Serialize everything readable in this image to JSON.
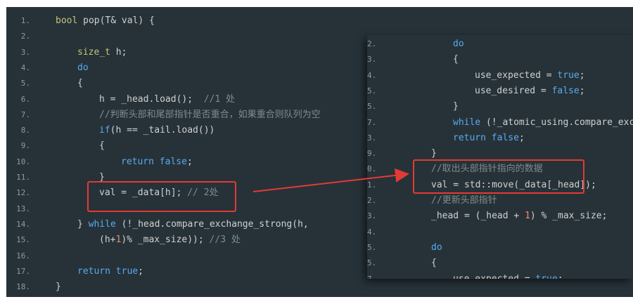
{
  "left_panel": {
    "lines": [
      {
        "n": "1.",
        "indent": 0,
        "tokens": [
          {
            "t": "bool",
            "c": "ty"
          },
          {
            "t": " pop(T& val) {",
            "c": "pl"
          }
        ]
      },
      {
        "n": "2.",
        "indent": 0,
        "tokens": []
      },
      {
        "n": "3.",
        "indent": 1,
        "tokens": [
          {
            "t": "size_t",
            "c": "ty"
          },
          {
            "t": " h;",
            "c": "pl"
          }
        ]
      },
      {
        "n": "4.",
        "indent": 1,
        "tokens": [
          {
            "t": "do",
            "c": "kw"
          }
        ]
      },
      {
        "n": "5.",
        "indent": 1,
        "tokens": [
          {
            "t": "{",
            "c": "pl"
          }
        ]
      },
      {
        "n": "6.",
        "indent": 2,
        "tokens": [
          {
            "t": "h = _head.load();  ",
            "c": "pl"
          },
          {
            "t": "//1 处",
            "c": "cm"
          }
        ]
      },
      {
        "n": "7.",
        "indent": 2,
        "tokens": [
          {
            "t": "//判断头部和尾部指针是否重合，如果重合则队列为空",
            "c": "cm"
          }
        ]
      },
      {
        "n": "8.",
        "indent": 2,
        "tokens": [
          {
            "t": "if",
            "c": "kw"
          },
          {
            "t": "(h == _tail.load())",
            "c": "pl"
          }
        ]
      },
      {
        "n": "9.",
        "indent": 2,
        "tokens": [
          {
            "t": "{",
            "c": "pl"
          }
        ]
      },
      {
        "n": "10.",
        "indent": 3,
        "tokens": [
          {
            "t": "return",
            "c": "kw"
          },
          {
            "t": " ",
            "c": "pl"
          },
          {
            "t": "false",
            "c": "kw"
          },
          {
            "t": ";",
            "c": "pl"
          }
        ]
      },
      {
        "n": "11.",
        "indent": 2,
        "tokens": [
          {
            "t": "}",
            "c": "pl"
          }
        ]
      },
      {
        "n": "12.",
        "indent": 2,
        "tokens": [
          {
            "t": "val = _data[h]; ",
            "c": "pl"
          },
          {
            "t": "// 2处",
            "c": "cm"
          }
        ]
      },
      {
        "n": "13.",
        "indent": 0,
        "tokens": []
      },
      {
        "n": "14.",
        "indent": 1,
        "tokens": [
          {
            "t": "} ",
            "c": "pl"
          },
          {
            "t": "while",
            "c": "kw"
          },
          {
            "t": " (!_head.compare_exchange_strong(h,",
            "c": "pl"
          }
        ]
      },
      {
        "n": "15.",
        "indent": 2,
        "tokens": [
          {
            "t": "(h+",
            "c": "pl"
          },
          {
            "t": "1",
            "c": "nm"
          },
          {
            "t": ")% _max_size)); ",
            "c": "pl"
          },
          {
            "t": "//3 处",
            "c": "cm"
          }
        ]
      },
      {
        "n": "16.",
        "indent": 0,
        "tokens": []
      },
      {
        "n": "17.",
        "indent": 1,
        "tokens": [
          {
            "t": "return",
            "c": "kw"
          },
          {
            "t": " ",
            "c": "pl"
          },
          {
            "t": "true",
            "c": "kw"
          },
          {
            "t": ";",
            "c": "pl"
          }
        ]
      },
      {
        "n": "18.",
        "indent": 0,
        "tokens": [
          {
            "t": "}",
            "c": "pl"
          }
        ]
      }
    ]
  },
  "popup_panel": {
    "lines": [
      {
        "n": "2.",
        "indent": 3,
        "tokens": [
          {
            "t": "do",
            "c": "kw"
          }
        ]
      },
      {
        "n": "3.",
        "indent": 3,
        "tokens": [
          {
            "t": "{",
            "c": "pl"
          }
        ]
      },
      {
        "n": "4.",
        "indent": 4,
        "tokens": [
          {
            "t": "use_expected = ",
            "c": "pl"
          },
          {
            "t": "true",
            "c": "kw"
          },
          {
            "t": ";",
            "c": "pl"
          }
        ]
      },
      {
        "n": "5.",
        "indent": 4,
        "tokens": [
          {
            "t": "use_desired = ",
            "c": "pl"
          },
          {
            "t": "false",
            "c": "kw"
          },
          {
            "t": ";",
            "c": "pl"
          }
        ]
      },
      {
        "n": "5.",
        "indent": 3,
        "tokens": [
          {
            "t": "}",
            "c": "pl"
          }
        ]
      },
      {
        "n": "7.",
        "indent": 3,
        "tokens": [
          {
            "t": "while",
            "c": "kw"
          },
          {
            "t": " (!_atomic_using.compare_excha",
            "c": "pl"
          }
        ]
      },
      {
        "n": "3.",
        "indent": 3,
        "tokens": [
          {
            "t": "return",
            "c": "kw"
          },
          {
            "t": " ",
            "c": "pl"
          },
          {
            "t": "false",
            "c": "kw"
          },
          {
            "t": ";",
            "c": "pl"
          }
        ]
      },
      {
        "n": "9.",
        "indent": 2,
        "tokens": [
          {
            "t": "}",
            "c": "pl"
          }
        ]
      },
      {
        "n": "0.",
        "indent": 2,
        "tokens": [
          {
            "t": "//取出头部指针指向的数据",
            "c": "cm"
          }
        ]
      },
      {
        "n": "1.",
        "indent": 2,
        "tokens": [
          {
            "t": "val = std::move(_data[_head]);",
            "c": "pl"
          }
        ]
      },
      {
        "n": "2.",
        "indent": 2,
        "tokens": [
          {
            "t": "//更新头部指针",
            "c": "cm"
          }
        ]
      },
      {
        "n": "3.",
        "indent": 2,
        "tokens": [
          {
            "t": "_head = (_head + ",
            "c": "pl"
          },
          {
            "t": "1",
            "c": "nm"
          },
          {
            "t": ") % _max_size;",
            "c": "pl"
          }
        ]
      },
      {
        "n": "4.",
        "indent": 0,
        "tokens": []
      },
      {
        "n": "5.",
        "indent": 2,
        "tokens": [
          {
            "t": "do",
            "c": "kw"
          }
        ]
      },
      {
        "n": "5.",
        "indent": 2,
        "tokens": [
          {
            "t": "{",
            "c": "pl"
          }
        ]
      },
      {
        "n": "7.",
        "indent": 3,
        "tokens": [
          {
            "t": "use_expected = ",
            "c": "pl"
          },
          {
            "t": "true",
            "c": "kw"
          },
          {
            "t": ";",
            "c": "pl"
          }
        ]
      }
    ]
  },
  "colors": {
    "panel_bg": "#263238",
    "keyword": "#5aa9f0",
    "type": "#c8c27a",
    "comment": "#7f8c8d",
    "number": "#f08a6a",
    "highlight": "#e53935"
  }
}
